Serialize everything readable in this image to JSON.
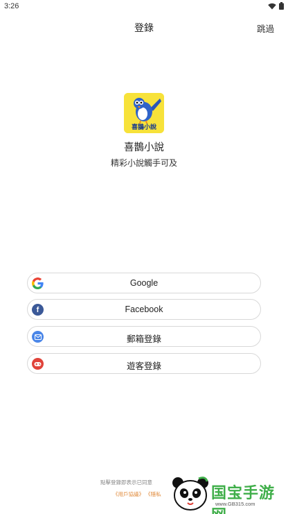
{
  "status_bar": {
    "time": "3:26"
  },
  "header": {
    "title": "登錄",
    "skip_label": "跳過"
  },
  "app": {
    "name": "喜鵲小說",
    "tagline": "精彩小說觸手可及",
    "logo_text": "喜鵲小說"
  },
  "login_options": [
    {
      "label": "Google",
      "icon": "google-icon"
    },
    {
      "label": "Facebook",
      "icon": "facebook-icon"
    },
    {
      "label": "郵箱登錄",
      "icon": "mail-icon"
    },
    {
      "label": "遊客登錄",
      "icon": "gamepad-icon"
    }
  ],
  "footer": {
    "agreement_text": "點擊登錄即表示已同意",
    "user_agreement_link": "《用戶協議》",
    "privacy_link": "《隱私"
  },
  "watermark": {
    "name": "国宝手游网",
    "url": "www.GB315.com"
  },
  "colors": {
    "accent_link": "#e08a3a",
    "logo_bg": "#f7e23a",
    "watermark_green": "#3fae49"
  }
}
